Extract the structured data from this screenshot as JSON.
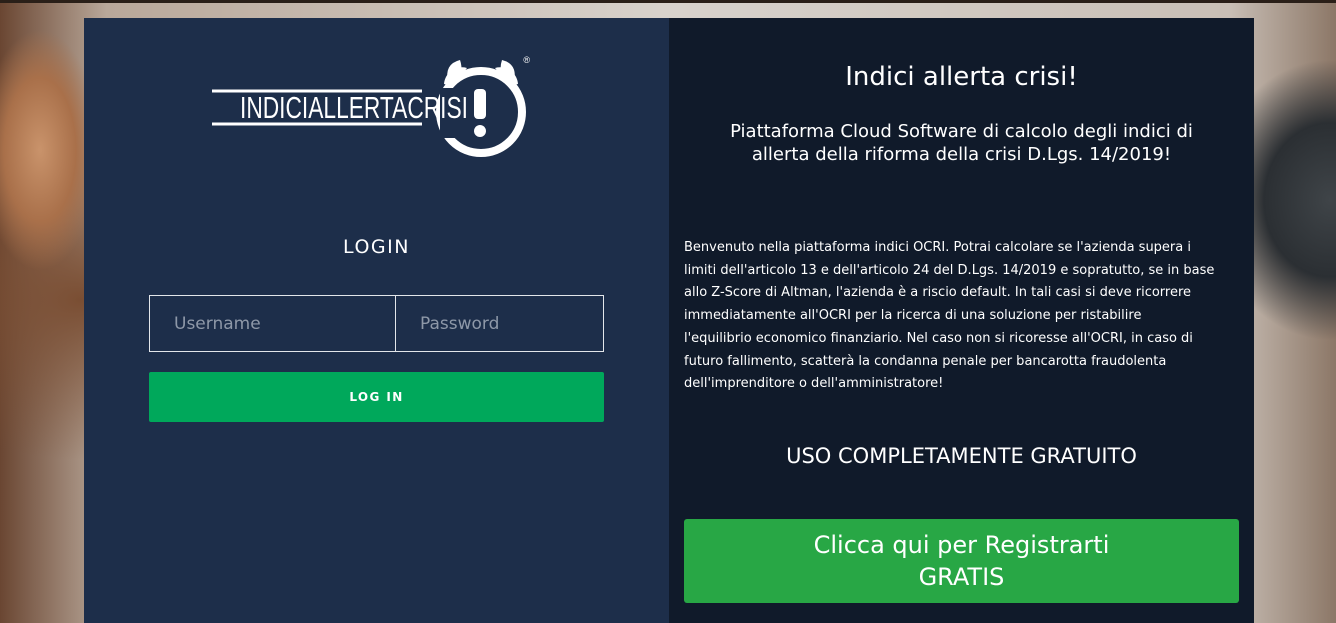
{
  "brand": {
    "logo_text": "INDICIALLERTACRISI",
    "registered_mark": "®"
  },
  "login": {
    "title": "LOGIN",
    "username_placeholder": "Username",
    "password_placeholder": "Password",
    "button_label": "LOG IN"
  },
  "info": {
    "title": "Indici allerta crisi!",
    "subtitle": "Piattaforma Cloud Software di calcolo degli indici di allerta della riforma della crisi D.Lgs. 14/2019!",
    "body_lines": [
      "Benvenuto nella piattaforma indici OCRI. Potrai calcolare se l'azienda supera i",
      "limiti dell'articolo 13 e dell'articolo 24 del D.Lgs. 14/2019 e sopratutto, se in base",
      "allo Z-Score di Altman, l'azienda è a riscio default. In tali casi si deve ricorrere",
      "immediatamente all'OCRI per la ricerca di una soluzione per ristabilire",
      "l'equilibrio economico finanziario. Nel caso non si ricoresse all'OCRI, in caso di",
      "futuro fallimento, scatterà la condanna penale per bancarotta fraudolenta",
      "dell'imprenditore o dell'amministratore!"
    ],
    "free_label": "USO COMPLETAMENTE GRATUITO",
    "register_line1": "Clicca qui per Registrarti",
    "register_line2": "GRATIS"
  },
  "colors": {
    "left_panel": "#1d2e4a",
    "right_panel": "#101a2a",
    "login_button": "#00a85b",
    "register_button": "#28a745"
  }
}
